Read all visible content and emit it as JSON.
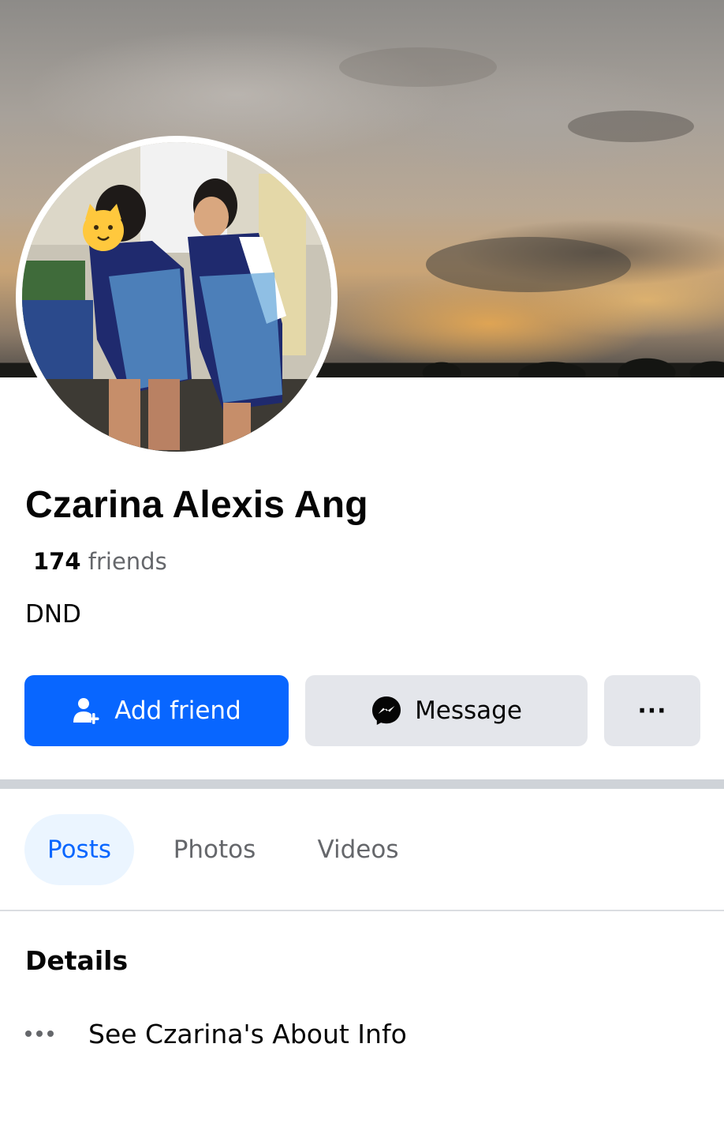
{
  "profile": {
    "name": "Czarina Alexis Ang",
    "friends_count": "174",
    "friends_label": "friends",
    "bio": "DND"
  },
  "actions": {
    "add_friend": "Add friend",
    "message": "Message",
    "more": "···"
  },
  "tabs": [
    {
      "label": "Posts",
      "active": true
    },
    {
      "label": "Photos",
      "active": false
    },
    {
      "label": "Videos",
      "active": false
    }
  ],
  "details": {
    "heading": "Details",
    "about_link": "See Czarina's About Info"
  },
  "colors": {
    "primary": "#0866ff",
    "secondary_button": "#e4e6eb",
    "active_tab_bg": "#ebf5ff",
    "muted_text": "#65676b"
  },
  "icons": {
    "add_friend": "person-add-icon",
    "message": "messenger-icon",
    "more": "more-horizontal-icon",
    "about": "more-horizontal-icon"
  }
}
